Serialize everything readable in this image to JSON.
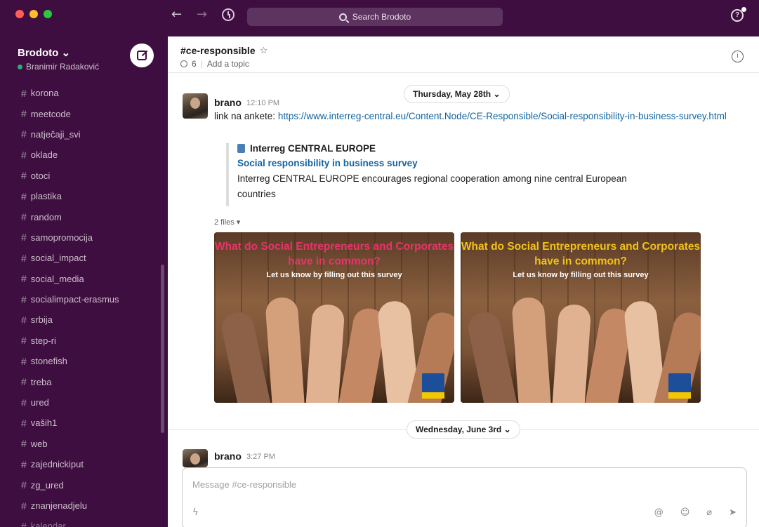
{
  "search": {
    "placeholder": "Search Brodoto"
  },
  "workspace": {
    "name": "Brodoto ⌄",
    "user": "Branimir Radaković"
  },
  "sidebar": {
    "channels": [
      {
        "label": "korona"
      },
      {
        "label": "meetcode"
      },
      {
        "label": "natječaji_svi"
      },
      {
        "label": "oklade"
      },
      {
        "label": "otoci"
      },
      {
        "label": "plastika"
      },
      {
        "label": "random"
      },
      {
        "label": "samopromocija"
      },
      {
        "label": "social_impact"
      },
      {
        "label": "social_media"
      },
      {
        "label": "socialimpact-erasmus"
      },
      {
        "label": "srbija"
      },
      {
        "label": "step-ri"
      },
      {
        "label": "stonefish"
      },
      {
        "label": "treba"
      },
      {
        "label": "ured"
      },
      {
        "label": "vaših1"
      },
      {
        "label": "web"
      },
      {
        "label": "zajednickiput"
      },
      {
        "label": "zg_ured"
      },
      {
        "label": "znanjenadjelu"
      },
      {
        "label": "kalendar"
      }
    ]
  },
  "channel": {
    "name": "#ce-responsible",
    "member_count": "6",
    "add_topic": "Add a topic",
    "info_icon": "info-icon",
    "star_icon": "star-icon"
  },
  "dates": {
    "first": "Thursday, May 28th ⌄",
    "second": "Wednesday, June 3rd ⌄"
  },
  "message1": {
    "author": "brano",
    "time": "12:10 PM",
    "text_prefix": "link na ankete: ",
    "link": "https://www.interreg-central.eu/Content.Node/CE-Responsible/Social-responsibility-in-business-survey.html",
    "unfurl": {
      "site": "Interreg CENTRAL EUROPE",
      "title": "Social responsibility in business survey",
      "description": "Interreg CENTRAL EUROPE encourages regional cooperation among nine central European countries"
    },
    "files_label": "2 files ▾",
    "files": [
      {
        "headline": "What do Social Entrepreneurs and Corporates have in common?",
        "subtext": "Let us know by filling out this survey",
        "headline_color": "#e8336b"
      },
      {
        "headline": "What do Social Entrepreneurs and Corporates have in common?",
        "subtext": "Let us know by filling out this survey",
        "headline_color": "#f2c21b"
      }
    ]
  },
  "message2": {
    "author": "brano",
    "time": "3:27 PM"
  },
  "composer": {
    "placeholder": "Message #ce-responsible"
  },
  "colors": {
    "sidebar": "#3f0e40",
    "link": "#1264a3",
    "presence": "#2bac76"
  }
}
